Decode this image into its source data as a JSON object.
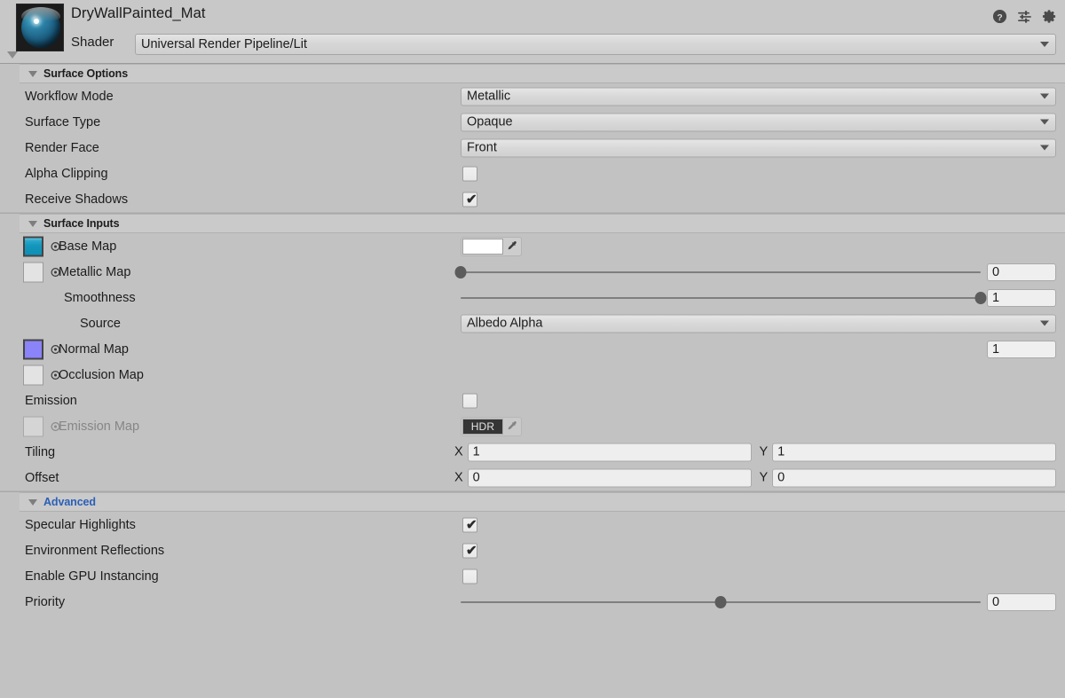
{
  "header": {
    "material_name": "DryWallPainted_Mat",
    "shader_label": "Shader",
    "shader_value": "Universal Render Pipeline/Lit",
    "icons": {
      "help": "help-icon",
      "preset": "preset-icon",
      "settings": "gear-icon"
    }
  },
  "sections": {
    "surface_options": {
      "title": "Surface Options",
      "rows": {
        "workflow_mode": {
          "label": "Workflow Mode",
          "value": "Metallic"
        },
        "surface_type": {
          "label": "Surface Type",
          "value": "Opaque"
        },
        "render_face": {
          "label": "Render Face",
          "value": "Front"
        },
        "alpha_clipping": {
          "label": "Alpha Clipping",
          "checked": false,
          "mark": ""
        },
        "receive_shadows": {
          "label": "Receive Shadows",
          "checked": true,
          "mark": "✔"
        }
      }
    },
    "surface_inputs": {
      "title": "Surface Inputs",
      "rows": {
        "base_map": {
          "label": "Base Map",
          "color": "#ffffff"
        },
        "metallic_map": {
          "label": "Metallic Map",
          "value": "0",
          "slider_pct": 0
        },
        "smoothness": {
          "label": "Smoothness",
          "value": "1",
          "slider_pct": 100
        },
        "source": {
          "label": "Source",
          "value": "Albedo Alpha"
        },
        "normal_map": {
          "label": "Normal Map",
          "value": "1"
        },
        "occlusion_map": {
          "label": "Occlusion Map"
        },
        "emission": {
          "label": "Emission",
          "checked": false,
          "mark": ""
        },
        "emission_map": {
          "label": "Emission Map",
          "hdr_badge": "HDR"
        },
        "tiling": {
          "label": "Tiling",
          "x_axis": "X",
          "x": "1",
          "y_axis": "Y",
          "y": "1"
        },
        "offset": {
          "label": "Offset",
          "x_axis": "X",
          "x": "0",
          "y_axis": "Y",
          "y": "0"
        }
      }
    },
    "advanced": {
      "title": "Advanced",
      "rows": {
        "specular_highlights": {
          "label": "Specular Highlights",
          "checked": true,
          "mark": "✔"
        },
        "environment_reflections": {
          "label": "Environment Reflections",
          "checked": true,
          "mark": "✔"
        },
        "enable_gpu_instancing": {
          "label": "Enable GPU Instancing",
          "checked": false,
          "mark": ""
        },
        "priority": {
          "label": "Priority",
          "value": "0",
          "slider_pct": 50
        }
      }
    }
  },
  "colors": {
    "background": "#c2c2c2",
    "header_band": "#cacaca",
    "advanced_accent": "#2b5fb8",
    "base_map_thumb": "#1496bc",
    "normal_map_thumb": "#8a84f8"
  }
}
